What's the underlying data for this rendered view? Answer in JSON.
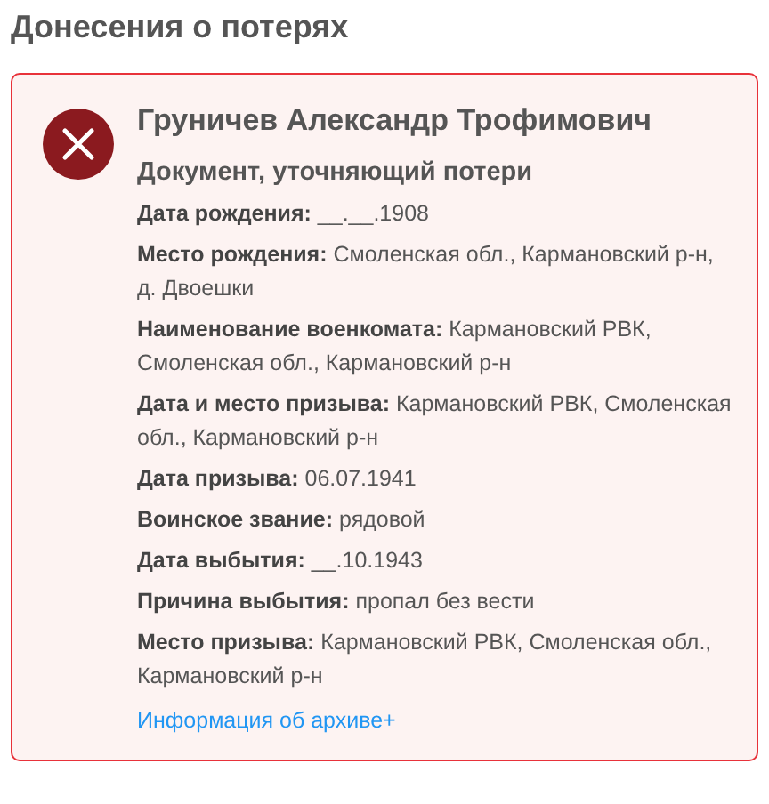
{
  "heading": "Донесения о потерях",
  "card": {
    "lost": true,
    "name": "Груничев Александр Трофимович",
    "document_type": "Документ, уточняющий потери",
    "fields": [
      "**Дата рождения:** __.__.1908",
      "**Место рождения:** Смоленская обл., Кармановский р-н, д. Двоешки",
      "**Наименование военкомата:** Кармановский РВК, Смоленская обл., Кармановский р-н",
      "**Дата и место призыва:** Кармановский РВК, Смоленская обл., Кармановский р-н",
      "**Дата призыва:** 06.07.1941",
      "**Воинское звание:** рядовой",
      "**Дата выбытия:** __.10.1943",
      "**Причина выбытия:** пропал без вести",
      "**Место призыва:** Кармановский РВК, Смоленская обл., Кармановский р-н"
    ],
    "archive_link": "Информация об архиве+"
  }
}
